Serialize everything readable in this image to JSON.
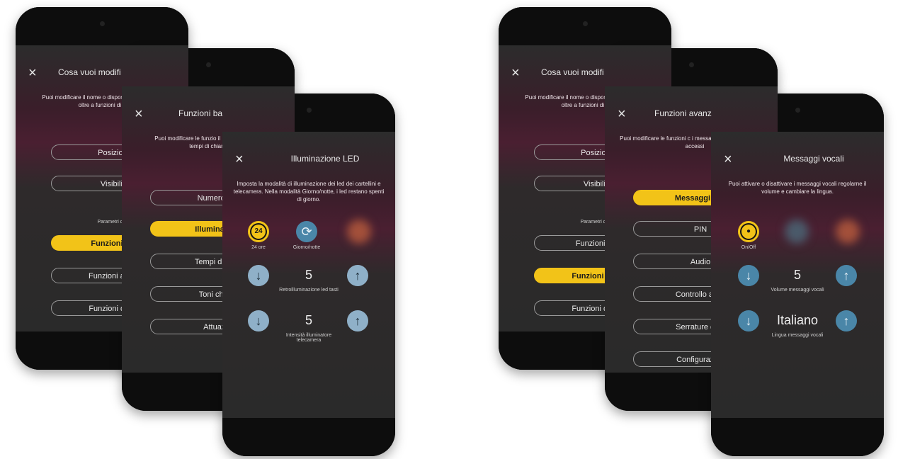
{
  "left": {
    "phone1": {
      "title": "Cosa vuoi modifi",
      "desc": "Puoi modificare il nome o dispositivo o l'ambiente in c oltre a funzioni di base e",
      "items": [
        "Posizione",
        "Visibilità"
      ],
      "section_label": "Parametri dispo",
      "items2": [
        "Funzioni bas",
        "Funzioni avanz",
        "Funzioni di acc"
      ]
    },
    "phone2": {
      "title": "Funzioni ba",
      "desc": "Puoi modificare le funzio il numero di pulsanti del i tempi di chiamata, le s",
      "items": [
        "Numero pul",
        "Illuminazion",
        "Tempi di chia",
        "Toni chiam",
        "Attuazio"
      ]
    },
    "phone3": {
      "title": "Illuminazione LED",
      "desc": "Imposta la modalità di illuminazione dei led dei cartellini e telecamera. Nella modalità Giorno/notte, i led restano spenti di giorno.",
      "mode1_label": "24 ore",
      "mode1_icon": "24",
      "mode2_label": "Giorno/notte",
      "value1": "5",
      "label1": "Retroilluminazione led tasti",
      "value2": "5",
      "label2": "Intensità illuminatore telecamera"
    }
  },
  "right": {
    "phone1": {
      "title": "Cosa vuoi modifi",
      "desc": "Puoi modificare il nome o dispositivo o l'ambiente in c oltre a funzioni di base e",
      "items": [
        "Posizione",
        "Visibilità"
      ],
      "section_label": "Parametri dispo",
      "items2": [
        "Funzioni bas",
        "Funzioni avan",
        "Funzioni di acc"
      ]
    },
    "phone2": {
      "title": "Funzioni avanz",
      "desc": "Puoi modificare le funzioni c i messaggi vocali, live controllo accessi",
      "items": [
        "Messaggi voc",
        "PIN",
        "Audio",
        "Controllo acce",
        "Serrature com",
        "Configurazion"
      ]
    },
    "phone3": {
      "title": "Messaggi vocali",
      "desc": "Puoi attivare o disattivare i messaggi vocali regolarne il volume e cambiare la lingua.",
      "toggle_label": "On/Off",
      "value1": "5",
      "label1": "Volume messaggi vocali",
      "value2": "Italiano",
      "label2": "Lingua messaggi vocali"
    }
  },
  "icons": {
    "close": "×",
    "down": "↓",
    "up": "↑",
    "sync": "⟳"
  },
  "colors": {
    "accent": "#f2c318",
    "round_button": "#8fb0c8"
  }
}
